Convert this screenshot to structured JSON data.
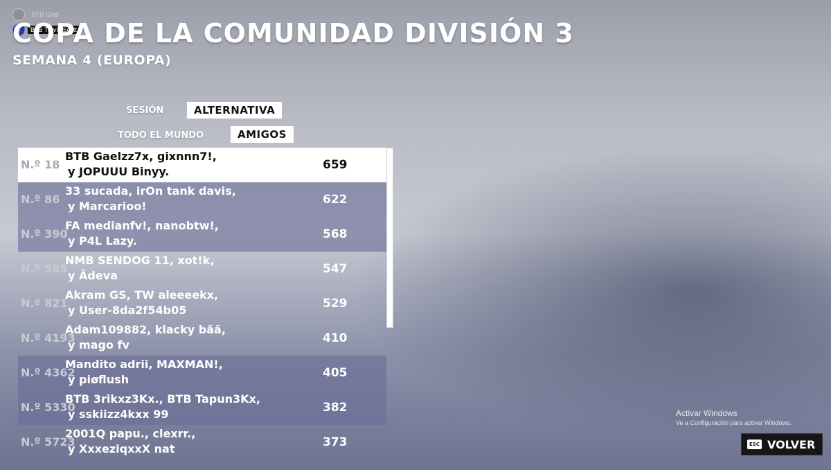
{
  "header": {
    "title": "COPA DE LA COMUNIDAD DIVISIÓN 3",
    "subtitle": "SEMANA 4 (EUROPA)"
  },
  "party": [
    {
      "name": "BTB Gael",
      "active": false
    },
    {
      "name": "BTB Travis Scott",
      "active": true
    }
  ],
  "filters": {
    "session_label": "SESIÓN",
    "session_value": "ALTERNATIVA",
    "scope_label": "TODO EL MUNDO",
    "scope_value": "AMIGOS"
  },
  "leaderboard": {
    "rows": [
      {
        "rank": "N.º 18",
        "line1": "BTB Gaelzz7x, gixnnn7!,",
        "line2": "y JOPUUU Binyy.",
        "score": "659",
        "style": "highlight"
      },
      {
        "rank": "N.º 86",
        "line1": "33 sucada, irOn tank davis,",
        "line2": "y Marcarioo!",
        "score": "622",
        "style": "shade"
      },
      {
        "rank": "N.º 390",
        "line1": "FA medianfv!, nanobtw!,",
        "line2": "y P4L Lazy.",
        "score": "568",
        "style": "shade"
      },
      {
        "rank": "N.º 585",
        "line1": "NMB SENDOG 11, xot!k,",
        "line2": "y Âdeva",
        "score": "547",
        "style": "plain"
      },
      {
        "rank": "N.º 821",
        "line1": "Akram GS, TW aleeeekx,",
        "line2": "y User-8da2f54b05",
        "score": "529",
        "style": "plain"
      },
      {
        "rank": "N.º 4193",
        "line1": "Adam109882, klacky bää,",
        "line2": "y mago fv",
        "score": "410",
        "style": "plain"
      },
      {
        "rank": "N.º 4362",
        "line1": "Mandito adrii, MAXMAN!,",
        "line2": "y piøflush",
        "score": "405",
        "style": "shade"
      },
      {
        "rank": "N.º 5330",
        "line1": "BTB 3rikxz3Kx., BTB Tapun3Kx,",
        "line2": "y sskiizz4kxx 99",
        "score": "382",
        "style": "shade"
      },
      {
        "rank": "N.º 5723",
        "line1": "2001Q papu., clexrr.,",
        "line2": "y XxxeziqxxX nat",
        "score": "373",
        "style": "plain"
      }
    ]
  },
  "watermark": {
    "title": "Activar Windows",
    "subtitle": "Ve a Configuración para activar Windows."
  },
  "back_button": {
    "key": "ESC",
    "label": "VOLVER"
  }
}
